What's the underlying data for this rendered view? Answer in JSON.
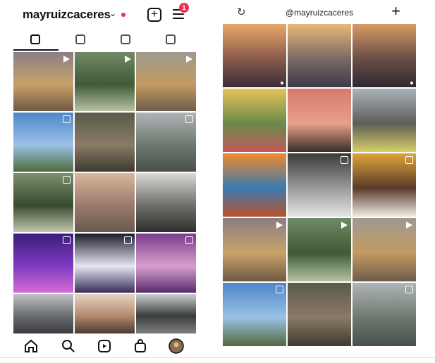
{
  "left_app": {
    "username": "mayruizcaceres",
    "chevron": "chevron-down-icon",
    "notification_count": "1",
    "tabs": [
      {
        "icon": "grid-icon",
        "active": true
      },
      {
        "icon": "reels-icon",
        "active": false
      },
      {
        "icon": "igtv-icon",
        "active": false
      },
      {
        "icon": "tagged-icon",
        "active": false
      }
    ],
    "grid": [
      {
        "badge": "reel",
        "colors": [
          "#8a7e86",
          "#c8a168",
          "#6f5a45"
        ]
      },
      {
        "badge": "reel",
        "colors": [
          "#6f8a64",
          "#3f5a34",
          "#b7c3a4"
        ]
      },
      {
        "badge": "reel",
        "colors": [
          "#9d9a8f",
          "#c39a62",
          "#6d5d4a"
        ]
      },
      {
        "badge": "multi",
        "colors": [
          "#4d86c9",
          "#9bc1e6",
          "#4f6a3c"
        ]
      },
      {
        "badge": "none",
        "colors": [
          "#5a5a4a",
          "#8a7a66",
          "#3e3a30"
        ]
      },
      {
        "badge": "multi",
        "colors": [
          "#b0b4b8",
          "#6c7a6e",
          "#4a4f4c"
        ]
      },
      {
        "badge": "multi",
        "colors": [
          "#7c8f6c",
          "#3a4a2e",
          "#c2c9b1"
        ]
      },
      {
        "badge": "none",
        "colors": [
          "#d8b79b",
          "#9a7a6a",
          "#6a5a4e"
        ]
      },
      {
        "badge": "none",
        "colors": [
          "#d9dbd6",
          "#6e6e6a",
          "#2f2f2f"
        ]
      },
      {
        "badge": "multi",
        "colors": [
          "#3b1d7a",
          "#7d3bc0",
          "#d66ad8"
        ]
      },
      {
        "badge": "multi",
        "colors": [
          "#1c1c30",
          "#e6e6f0",
          "#3a2e5a"
        ]
      },
      {
        "badge": "multi",
        "colors": [
          "#7a3a8c",
          "#d8a0d0",
          "#5a2a6a"
        ]
      },
      {
        "badge": "none",
        "colors": [
          "#bfc2c4",
          "#6a6d70",
          "#3a3c3f"
        ]
      },
      {
        "badge": "none",
        "colors": [
          "#e5d3c4",
          "#b48a6e",
          "#4a3a30"
        ]
      },
      {
        "badge": "none",
        "colors": [
          "#cdd0cf",
          "#3a3c3e",
          "#7d7f80"
        ]
      }
    ],
    "bottom_nav": [
      "home-icon",
      "search-icon",
      "reels-icon",
      "shop-icon",
      "profile-avatar"
    ]
  },
  "right_app": {
    "handle": "@mayruizcaceres",
    "sync_icon": "refresh-icon",
    "add_icon": "plus-icon",
    "grid": [
      {
        "badge": "dot",
        "colors": [
          "#e8a96a",
          "#8a5a4a",
          "#3a2f3a"
        ]
      },
      {
        "badge": "none",
        "colors": [
          "#e9b879",
          "#7a6a66",
          "#3c3a44"
        ]
      },
      {
        "badge": "dot",
        "colors": [
          "#d89c62",
          "#6a4e48",
          "#2e2a30"
        ]
      },
      {
        "badge": "none",
        "colors": [
          "#e6c356",
          "#6a8a4a",
          "#c05a5a"
        ]
      },
      {
        "badge": "none",
        "colors": [
          "#d47a6a",
          "#e6a08a",
          "#3a2e2a"
        ]
      },
      {
        "badge": "none",
        "colors": [
          "#a9b3b8",
          "#5e5e58",
          "#d8cf6a"
        ]
      },
      {
        "badge": "none",
        "colors": [
          "#f08a2a",
          "#3a7ab0",
          "#b8522a"
        ]
      },
      {
        "badge": "multi",
        "colors": [
          "#3a3a3a",
          "#9a9a9a",
          "#e5e5e5"
        ]
      },
      {
        "badge": "multi",
        "colors": [
          "#e0a43a",
          "#5a3a2a",
          "#f0ece4"
        ]
      },
      {
        "badge": "reel",
        "colors": [
          "#8a7e86",
          "#c8a168",
          "#6f5a45"
        ]
      },
      {
        "badge": "reel",
        "colors": [
          "#6f8a64",
          "#3f5a34",
          "#b7c3a4"
        ]
      },
      {
        "badge": "reel",
        "colors": [
          "#9d9a8f",
          "#c39a62",
          "#6d5d4a"
        ]
      },
      {
        "badge": "multi",
        "colors": [
          "#4d86c9",
          "#9bc1e6",
          "#4f6a3c"
        ]
      },
      {
        "badge": "none",
        "colors": [
          "#5a5a4a",
          "#8a7a66",
          "#3e3a30"
        ]
      },
      {
        "badge": "multi",
        "colors": [
          "#b0b4b8",
          "#6c7a6e",
          "#4a4f4c"
        ]
      }
    ]
  }
}
